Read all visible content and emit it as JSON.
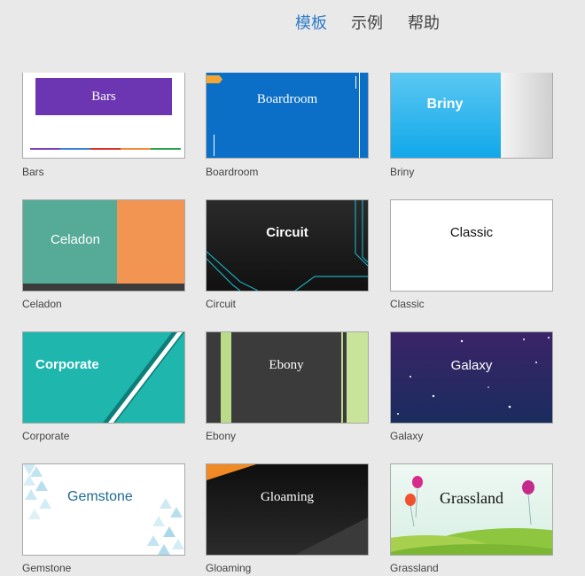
{
  "tabs": {
    "templates": "模板",
    "examples": "示例",
    "help": "帮助"
  },
  "templates": [
    {
      "caption": "Bars",
      "title": "Bars"
    },
    {
      "caption": "Boardroom",
      "title": "Boardroom"
    },
    {
      "caption": "Briny",
      "title": "Briny"
    },
    {
      "caption": "Celadon",
      "title": "Celadon"
    },
    {
      "caption": "Circuit",
      "title": "Circuit"
    },
    {
      "caption": "Classic",
      "title": "Classic"
    },
    {
      "caption": "Corporate",
      "title": "Corporate"
    },
    {
      "caption": "Ebony",
      "title": "Ebony"
    },
    {
      "caption": "Galaxy",
      "title": "Galaxy"
    },
    {
      "caption": "Gemstone",
      "title": "Gemstone"
    },
    {
      "caption": "Gloaming",
      "title": "Gloaming"
    },
    {
      "caption": "Grassland",
      "title": "Grassland"
    }
  ],
  "colors": {
    "accent": "#2e7bc6",
    "background": "#e9e9e9"
  }
}
